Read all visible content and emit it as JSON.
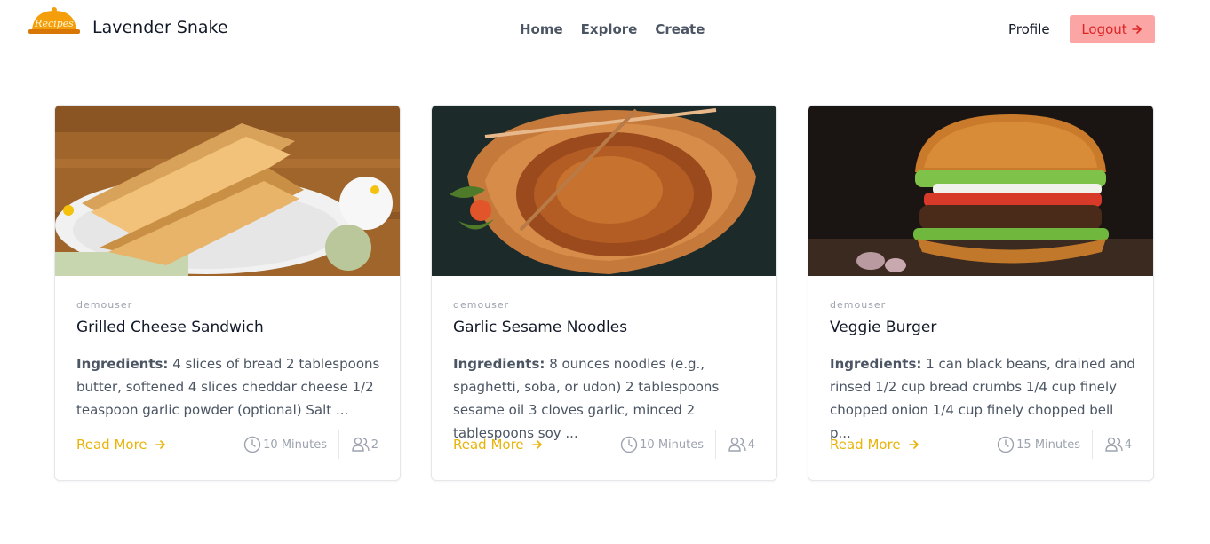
{
  "header": {
    "logo_text": "Recipes",
    "brand": "Lavender Snake",
    "nav": [
      "Home",
      "Explore",
      "Create"
    ],
    "profile": "Profile",
    "logout": "Logout",
    "logout_icon": "arrow-right-icon"
  },
  "cards": [
    {
      "author": "demouser",
      "title": "Grilled Cheese Sandwich",
      "ingredients_label": "Ingredients:",
      "ingredients": "4 slices of bread 2 tablespoons butter, softened 4 slices cheddar cheese 1/2 teaspoon garlic powder (optional) Salt ...",
      "read_more": "Read More",
      "time": "10 Minutes",
      "servings": "2"
    },
    {
      "author": "demouser",
      "title": "Garlic Sesame Noodles",
      "ingredients_label": "Ingredients:",
      "ingredients": "8 ounces noodles (e.g., spaghetti, soba, or udon) 2 tablespoons sesame oil 3 cloves garlic, minced 2 tablespoons soy ...",
      "read_more": "Read More",
      "time": "10 Minutes",
      "servings": "4"
    },
    {
      "author": "demouser",
      "title": "Veggie Burger",
      "ingredients_label": "Ingredients:",
      "ingredients": "1 can black beans, drained and rinsed 1/2 cup bread crumbs 1/4 cup finely chopped onion 1/4 cup finely chopped bell p...",
      "read_more": "Read More",
      "time": "15 Minutes",
      "servings": "4"
    }
  ],
  "colors": {
    "accent": "#eab308",
    "logout_bg": "#fca5a5",
    "logout_text": "#dc2626"
  }
}
